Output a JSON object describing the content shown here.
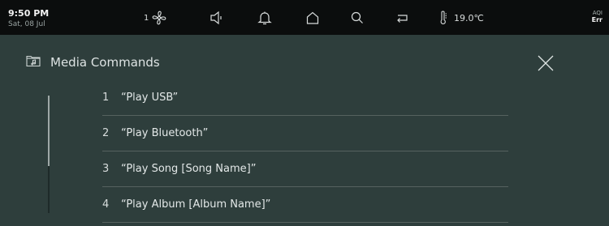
{
  "status_bar": {
    "time": "9:50 PM",
    "date": "Sat, 08 Jul",
    "fan_level": "1",
    "temperature": "19.0℃",
    "aqi_label": "AQI",
    "aqi_value": "Err",
    "icons": [
      "fan-icon",
      "speaker-icon",
      "bell-icon",
      "home-icon",
      "search-icon",
      "back-icon",
      "thermometer-icon"
    ]
  },
  "panel": {
    "title": "Media Commands",
    "title_icon": "music-folder-icon",
    "close_icon": "close-icon",
    "commands": [
      {
        "number": "1",
        "text": "“Play USB”"
      },
      {
        "number": "2",
        "text": "“Play Bluetooth”"
      },
      {
        "number": "3",
        "text": "“Play Song [Song Name]”"
      },
      {
        "number": "4",
        "text": "“Play Album [Album Name]”"
      }
    ],
    "scroll_position_fraction": 0.6
  },
  "colors": {
    "status_bar_bg": "#0b0d0d",
    "panel_bg": "#2e3e3c",
    "divider": "#56625f"
  }
}
